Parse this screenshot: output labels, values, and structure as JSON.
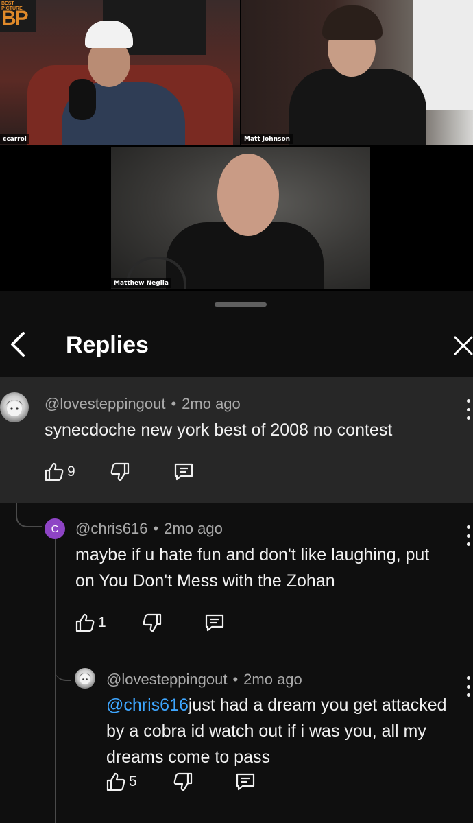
{
  "video": {
    "logo": {
      "small": "BEST PICTURE",
      "big": "BP"
    },
    "participants": [
      {
        "name": "ccarrol"
      },
      {
        "name": "Matt Johnson"
      },
      {
        "name": "Matthew Neglia"
      }
    ]
  },
  "header": {
    "title": "Replies"
  },
  "colors": {
    "accent_link": "#3ea6ff",
    "avatar_c": "#8e44c5",
    "background": "#0f0f0f",
    "highlight": "#272727"
  },
  "comments": [
    {
      "author": "@lovesteppingout",
      "time": "2mo ago",
      "text": "synecdoche new york best of 2008 no contest",
      "likes": "9",
      "avatar_icon": "anime-avatar-icon"
    },
    {
      "author": "@chris616",
      "time": "2mo ago",
      "text": "maybe if u hate fun and don't like laughing, put on You Don't Mess with the Zohan",
      "likes": "1",
      "avatar_letter": "C"
    },
    {
      "author": "@lovesteppingout",
      "time": "2mo ago",
      "mention": "@chris616",
      "text": "just had a dream you get attacked by a cobra id watch out if i was you, all my dreams come to pass",
      "likes": "5",
      "avatar_icon": "anime-avatar-icon"
    }
  ]
}
